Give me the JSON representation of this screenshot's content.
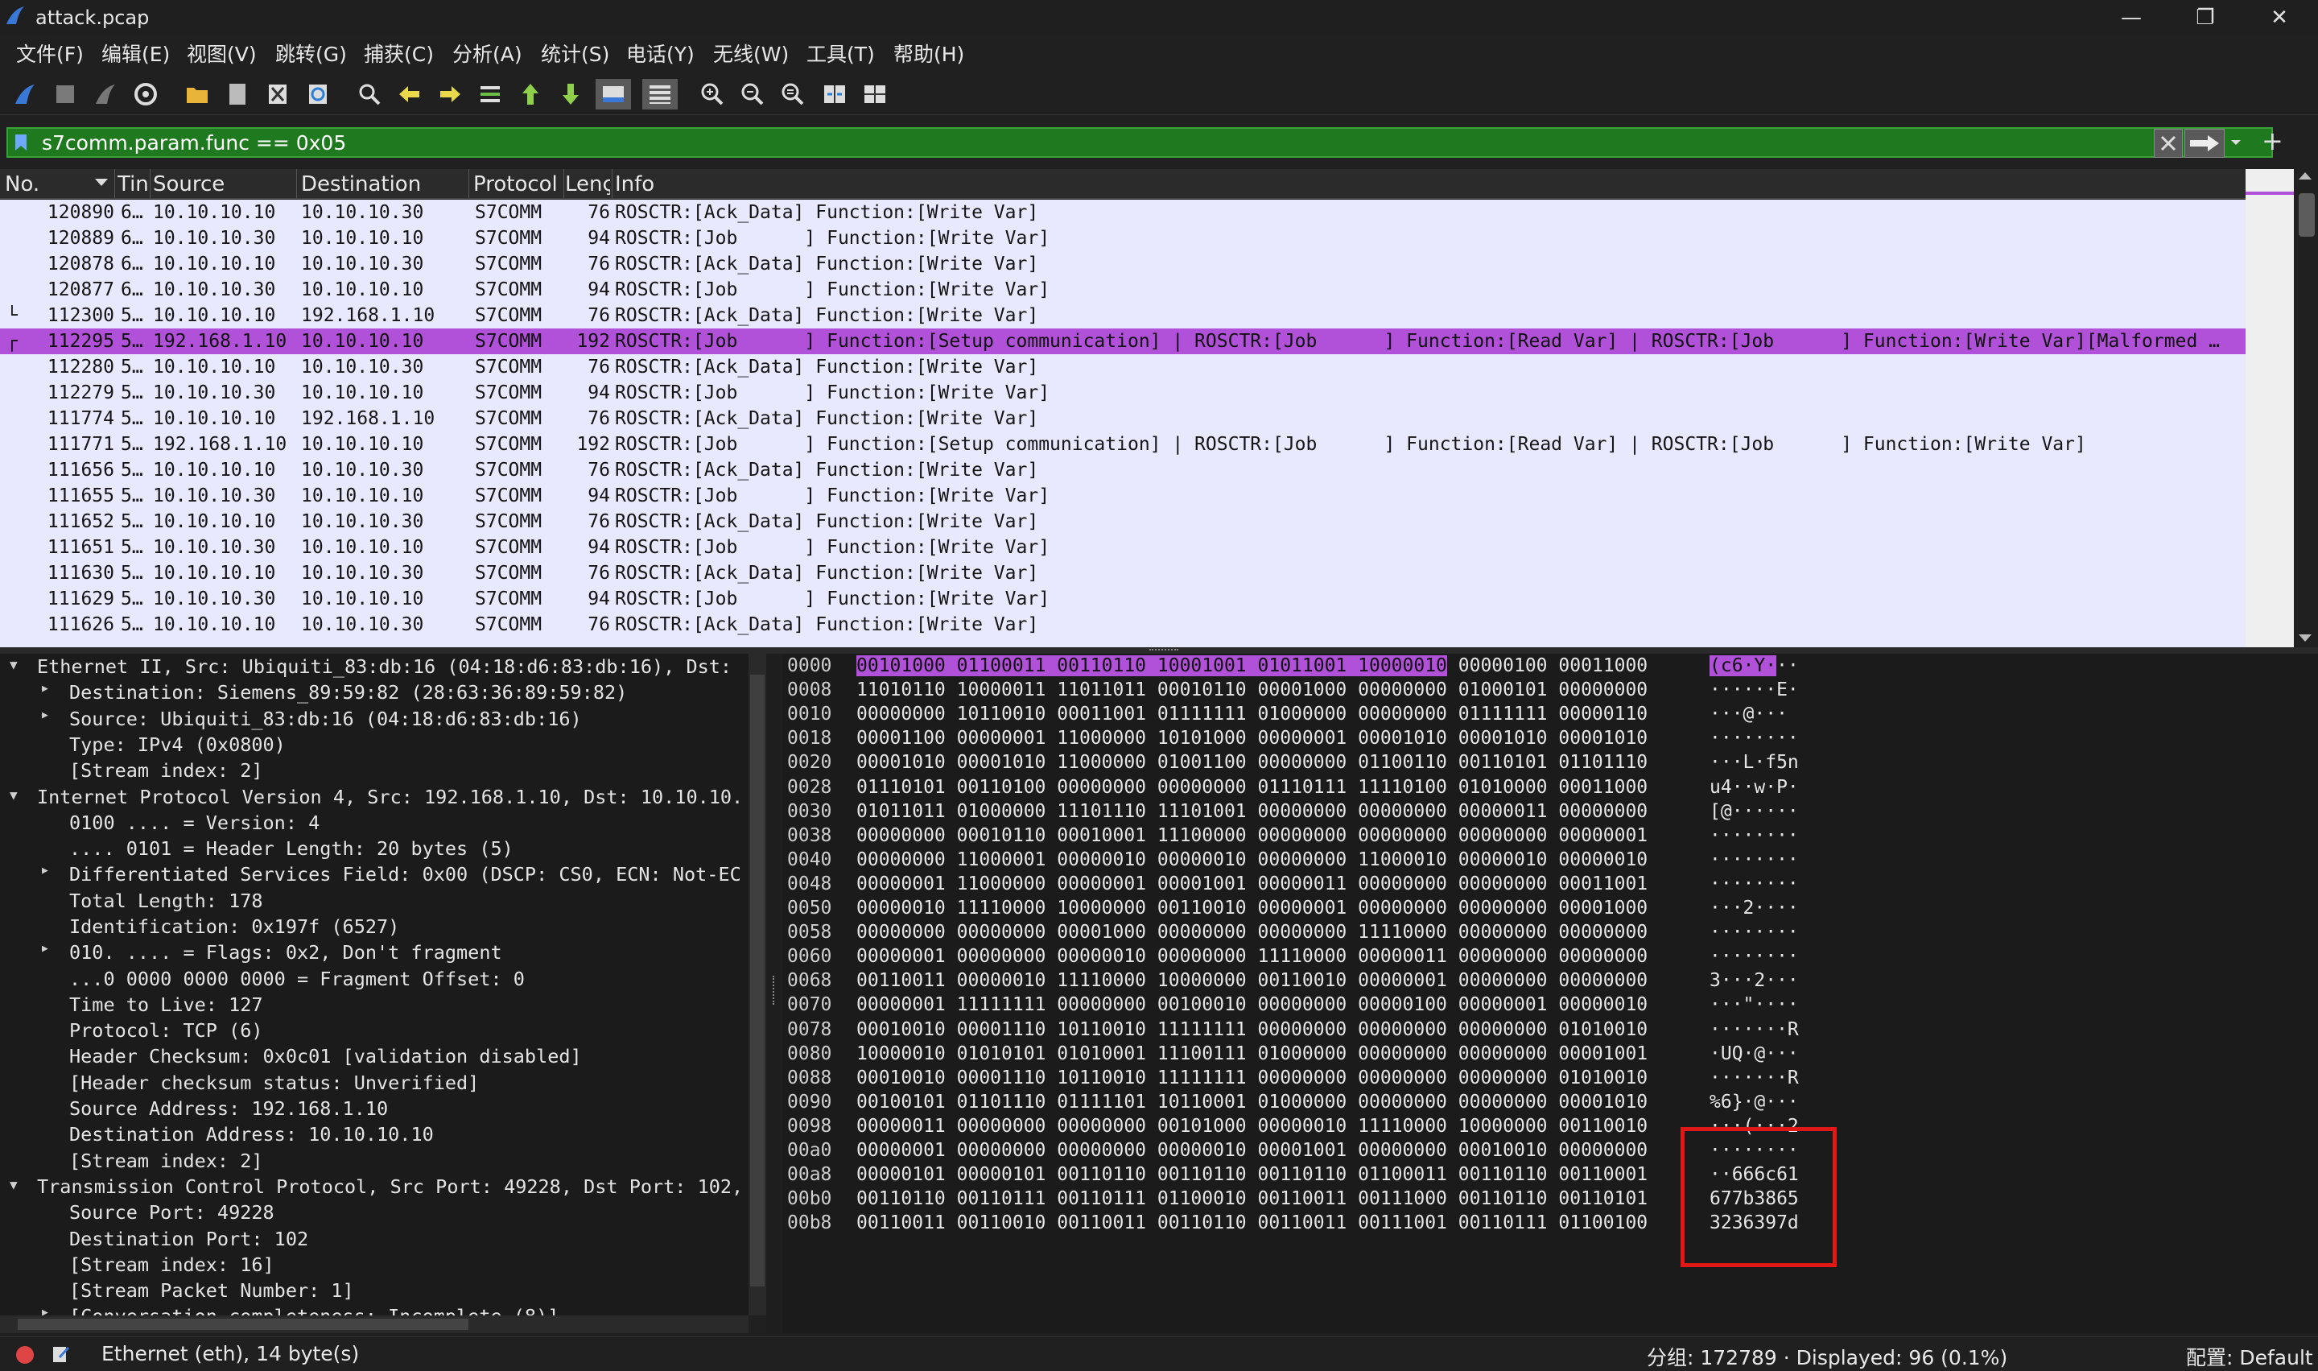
{
  "window": {
    "title": "attack.pcap",
    "minimize": "—",
    "restore": "❐",
    "close": "✕"
  },
  "menu": [
    "文件(F)",
    "编辑(E)",
    "视图(V)",
    "跳转(G)",
    "捕获(C)",
    "分析(A)",
    "统计(S)",
    "电话(Y)",
    "无线(W)",
    "工具(T)",
    "帮助(H)"
  ],
  "toolbar_icons": [
    "shark-fin-start-icon",
    "stop-square-icon",
    "restart-fin-icon",
    "capture-options-gear-icon",
    "open-folder-icon",
    "file-icon",
    "close-file-icon",
    "reload-icon",
    "find-magnifier-icon",
    "go-back-arrow-icon",
    "go-forward-arrow-icon",
    "go-to-packet-icon",
    "first-packet-icon",
    "last-packet-icon",
    "autoscroll-icon",
    "colorize-icon",
    "zoom-in-icon",
    "zoom-out-icon",
    "zoom-normal-icon",
    "resize-columns-icon",
    "layout-grid-icon"
  ],
  "filter": {
    "value": "s7comm.param.func == 0x05"
  },
  "packet_list": {
    "columns": [
      "No.",
      "Tin",
      "Source",
      "Destination",
      "Protocol",
      "Lenç",
      "Info"
    ],
    "rows": [
      {
        "no": "120890",
        "time": "6…",
        "src": "10.10.10.10",
        "dst": "10.10.10.30",
        "proto": "S7COMM",
        "len": "76",
        "info": "ROSCTR:[Ack_Data] Function:[Write Var]",
        "marker": ""
      },
      {
        "no": "120889",
        "time": "6…",
        "src": "10.10.10.30",
        "dst": "10.10.10.10",
        "proto": "S7COMM",
        "len": "94",
        "info": "ROSCTR:[Job      ] Function:[Write Var]",
        "marker": ""
      },
      {
        "no": "120878",
        "time": "6…",
        "src": "10.10.10.10",
        "dst": "10.10.10.30",
        "proto": "S7COMM",
        "len": "76",
        "info": "ROSCTR:[Ack_Data] Function:[Write Var]",
        "marker": ""
      },
      {
        "no": "120877",
        "time": "6…",
        "src": "10.10.10.30",
        "dst": "10.10.10.10",
        "proto": "S7COMM",
        "len": "94",
        "info": "ROSCTR:[Job      ] Function:[Write Var]",
        "marker": ""
      },
      {
        "no": "112300",
        "time": "5…",
        "src": "10.10.10.10",
        "dst": "192.168.1.10",
        "proto": "S7COMM",
        "len": "76",
        "info": "ROSCTR:[Ack_Data] Function:[Write Var]",
        "marker": "└"
      },
      {
        "no": "112295",
        "time": "5…",
        "src": "192.168.1.10",
        "dst": "10.10.10.10",
        "proto": "S7COMM",
        "len": "192",
        "info": "ROSCTR:[Job      ] Function:[Setup communication] | ROSCTR:[Job      ] Function:[Read Var] | ROSCTR:[Job      ] Function:[Write Var][Malformed …",
        "marker": "┌",
        "selected": true
      },
      {
        "no": "112280",
        "time": "5…",
        "src": "10.10.10.10",
        "dst": "10.10.10.30",
        "proto": "S7COMM",
        "len": "76",
        "info": "ROSCTR:[Ack_Data] Function:[Write Var]",
        "marker": ""
      },
      {
        "no": "112279",
        "time": "5…",
        "src": "10.10.10.30",
        "dst": "10.10.10.10",
        "proto": "S7COMM",
        "len": "94",
        "info": "ROSCTR:[Job      ] Function:[Write Var]",
        "marker": ""
      },
      {
        "no": "111774",
        "time": "5…",
        "src": "10.10.10.10",
        "dst": "192.168.1.10",
        "proto": "S7COMM",
        "len": "76",
        "info": "ROSCTR:[Ack_Data] Function:[Write Var]",
        "marker": ""
      },
      {
        "no": "111771",
        "time": "5…",
        "src": "192.168.1.10",
        "dst": "10.10.10.10",
        "proto": "S7COMM",
        "len": "192",
        "info": "ROSCTR:[Job      ] Function:[Setup communication] | ROSCTR:[Job      ] Function:[Read Var] | ROSCTR:[Job      ] Function:[Write Var]",
        "marker": ""
      },
      {
        "no": "111656",
        "time": "5…",
        "src": "10.10.10.10",
        "dst": "10.10.10.30",
        "proto": "S7COMM",
        "len": "76",
        "info": "ROSCTR:[Ack_Data] Function:[Write Var]",
        "marker": ""
      },
      {
        "no": "111655",
        "time": "5…",
        "src": "10.10.10.30",
        "dst": "10.10.10.10",
        "proto": "S7COMM",
        "len": "94",
        "info": "ROSCTR:[Job      ] Function:[Write Var]",
        "marker": ""
      },
      {
        "no": "111652",
        "time": "5…",
        "src": "10.10.10.10",
        "dst": "10.10.10.30",
        "proto": "S7COMM",
        "len": "76",
        "info": "ROSCTR:[Ack_Data] Function:[Write Var]",
        "marker": ""
      },
      {
        "no": "111651",
        "time": "5…",
        "src": "10.10.10.30",
        "dst": "10.10.10.10",
        "proto": "S7COMM",
        "len": "94",
        "info": "ROSCTR:[Job      ] Function:[Write Var]",
        "marker": ""
      },
      {
        "no": "111630",
        "time": "5…",
        "src": "10.10.10.10",
        "dst": "10.10.10.30",
        "proto": "S7COMM",
        "len": "76",
        "info": "ROSCTR:[Ack_Data] Function:[Write Var]",
        "marker": ""
      },
      {
        "no": "111629",
        "time": "5…",
        "src": "10.10.10.30",
        "dst": "10.10.10.10",
        "proto": "S7COMM",
        "len": "94",
        "info": "ROSCTR:[Job      ] Function:[Write Var]",
        "marker": ""
      },
      {
        "no": "111626",
        "time": "5…",
        "src": "10.10.10.10",
        "dst": "10.10.10.30",
        "proto": "S7COMM",
        "len": "76",
        "info": "ROSCTR:[Ack_Data] Function:[Write Var]",
        "marker": ""
      }
    ]
  },
  "details": [
    {
      "text": "Ethernet II, Src: Ubiquiti_83:db:16 (04:18:d6:83:db:16), Dst:",
      "level": 0,
      "arrow": "down"
    },
    {
      "text": "Destination: Siemens_89:59:82 (28:63:36:89:59:82)",
      "level": 1,
      "arrow": "right"
    },
    {
      "text": "Source: Ubiquiti_83:db:16 (04:18:d6:83:db:16)",
      "level": 1,
      "arrow": "right"
    },
    {
      "text": "Type: IPv4 (0x0800)",
      "level": 1,
      "arrow": ""
    },
    {
      "text": "[Stream index: 2]",
      "level": 1,
      "arrow": ""
    },
    {
      "text": "Internet Protocol Version 4, Src: 192.168.1.10, Dst: 10.10.10.",
      "level": 0,
      "arrow": "down"
    },
    {
      "text": "0100 .... = Version: 4",
      "level": 1,
      "arrow": ""
    },
    {
      "text": ".... 0101 = Header Length: 20 bytes (5)",
      "level": 1,
      "arrow": ""
    },
    {
      "text": "Differentiated Services Field: 0x00 (DSCP: CS0, ECN: Not-EC",
      "level": 1,
      "arrow": "right"
    },
    {
      "text": "Total Length: 178",
      "level": 1,
      "arrow": ""
    },
    {
      "text": "Identification: 0x197f (6527)",
      "level": 1,
      "arrow": ""
    },
    {
      "text": "010. .... = Flags: 0x2, Don't fragment",
      "level": 1,
      "arrow": "right"
    },
    {
      "text": "...0 0000 0000 0000 = Fragment Offset: 0",
      "level": 1,
      "arrow": ""
    },
    {
      "text": "Time to Live: 127",
      "level": 1,
      "arrow": ""
    },
    {
      "text": "Protocol: TCP (6)",
      "level": 1,
      "arrow": ""
    },
    {
      "text": "Header Checksum: 0x0c01 [validation disabled]",
      "level": 1,
      "arrow": ""
    },
    {
      "text": "[Header checksum status: Unverified]",
      "level": 1,
      "arrow": ""
    },
    {
      "text": "Source Address: 192.168.1.10",
      "level": 1,
      "arrow": ""
    },
    {
      "text": "Destination Address: 10.10.10.10",
      "level": 1,
      "arrow": ""
    },
    {
      "text": "[Stream index: 2]",
      "level": 1,
      "arrow": ""
    },
    {
      "text": "Transmission Control Protocol, Src Port: 49228, Dst Port: 102,",
      "level": 0,
      "arrow": "down"
    },
    {
      "text": "Source Port: 49228",
      "level": 1,
      "arrow": ""
    },
    {
      "text": "Destination Port: 102",
      "level": 1,
      "arrow": ""
    },
    {
      "text": "[Stream index: 16]",
      "level": 1,
      "arrow": ""
    },
    {
      "text": "[Stream Packet Number: 1]",
      "level": 1,
      "arrow": ""
    },
    {
      "text": "[Conversation completeness: Incomplete (8)]",
      "level": 1,
      "arrow": "right"
    }
  ],
  "bytes": [
    {
      "off": "0000",
      "hex": "00101000 01100011 00110110 10001001 01011001 10000010 00000100 00011000",
      "ascii": "(c6·Y···",
      "hl_hex": "00101000 01100011 00110110 10001001 01011001 10000010",
      "hl_ascii": "(c6·Y·"
    },
    {
      "off": "0008",
      "hex": "11010110 10000011 11011011 00010110 00001000 00000000 01000101 00000000",
      "ascii": "······E·"
    },
    {
      "off": "0010",
      "hex": "00000000 10110010 00011001 01111111 01000000 00000000 01111111 00000110",
      "ascii": "···@···"
    },
    {
      "off": "0018",
      "hex": "00001100 00000001 11000000 10101000 00000001 00001010 00001010 00001010",
      "ascii": "········"
    },
    {
      "off": "0020",
      "hex": "00001010 00001010 11000000 01001100 00000000 01100110 00110101 01101110",
      "ascii": "···L·f5n"
    },
    {
      "off": "0028",
      "hex": "01110101 00110100 00000000 00000000 01110111 11110100 01010000 00011000",
      "ascii": "u4··w·P·"
    },
    {
      "off": "0030",
      "hex": "01011011 01000000 11101110 11101001 00000000 00000000 00000011 00000000",
      "ascii": "[@······"
    },
    {
      "off": "0038",
      "hex": "00000000 00010110 00010001 11100000 00000000 00000000 00000000 00000001",
      "ascii": "········"
    },
    {
      "off": "0040",
      "hex": "00000000 11000001 00000010 00000010 00000000 11000010 00000010 00000010",
      "ascii": "········"
    },
    {
      "off": "0048",
      "hex": "00000001 11000000 00000001 00001001 00000011 00000000 00000000 00011001",
      "ascii": "········"
    },
    {
      "off": "0050",
      "hex": "00000010 11110000 10000000 00110010 00000001 00000000 00000000 00001000",
      "ascii": "···2····"
    },
    {
      "off": "0058",
      "hex": "00000000 00000000 00001000 00000000 00000000 11110000 00000000 00000000",
      "ascii": "········"
    },
    {
      "off": "0060",
      "hex": "00000001 00000000 00000010 00000000 11110000 00000011 00000000 00000000",
      "ascii": "········"
    },
    {
      "off": "0068",
      "hex": "00110011 00000010 11110000 10000000 00110010 00000001 00000000 00000000",
      "ascii": "3···2···"
    },
    {
      "off": "0070",
      "hex": "00000001 11111111 00000000 00100010 00000000 00000100 00000001 00000010",
      "ascii": "···\"····"
    },
    {
      "off": "0078",
      "hex": "00010010 00001110 10110010 11111111 00000000 00000000 00000000 01010010",
      "ascii": "·······R"
    },
    {
      "off": "0080",
      "hex": "10000010 01010101 01010001 11100111 01000000 00000000 00000000 00001001",
      "ascii": "·UQ·@···"
    },
    {
      "off": "0088",
      "hex": "00010010 00001110 10110010 11111111 00000000 00000000 00000000 01010010",
      "ascii": "·······R"
    },
    {
      "off": "0090",
      "hex": "00100101 01101110 01111101 10110001 01000000 00000000 00000000 00001010",
      "ascii": "%6}·@···"
    },
    {
      "off": "0098",
      "hex": "00000011 00000000 00000000 00101000 00000010 11110000 10000000 00110010",
      "ascii": "···(···2"
    },
    {
      "off": "00a0",
      "hex": "00000001 00000000 00000000 00000010 00001001 00000000 00010010 00000000",
      "ascii": "········"
    },
    {
      "off": "00a8",
      "hex": "00000101 00000101 00110110 00110110 00110110 01100011 00110110 00110001",
      "ascii": "··666c61"
    },
    {
      "off": "00b0",
      "hex": "00110110 00110111 00110111 01100010 00110011 00111000 00110110 00110101",
      "ascii": "677b3865"
    },
    {
      "off": "00b8",
      "hex": "00110011 00110010 00110011 00110110 00110011 00111001 00110111 01100100",
      "ascii": "3236397d"
    }
  ],
  "status": {
    "left": "Ethernet (eth), 14 byte(s)",
    "middle": "分组: 172789 · Displayed: 96 (0.1%)",
    "right": "配置: Default"
  },
  "colors": {
    "selected_row": "#b150d8",
    "filter_bg": "#1f7a1f",
    "annotation_box": "#e01818"
  }
}
